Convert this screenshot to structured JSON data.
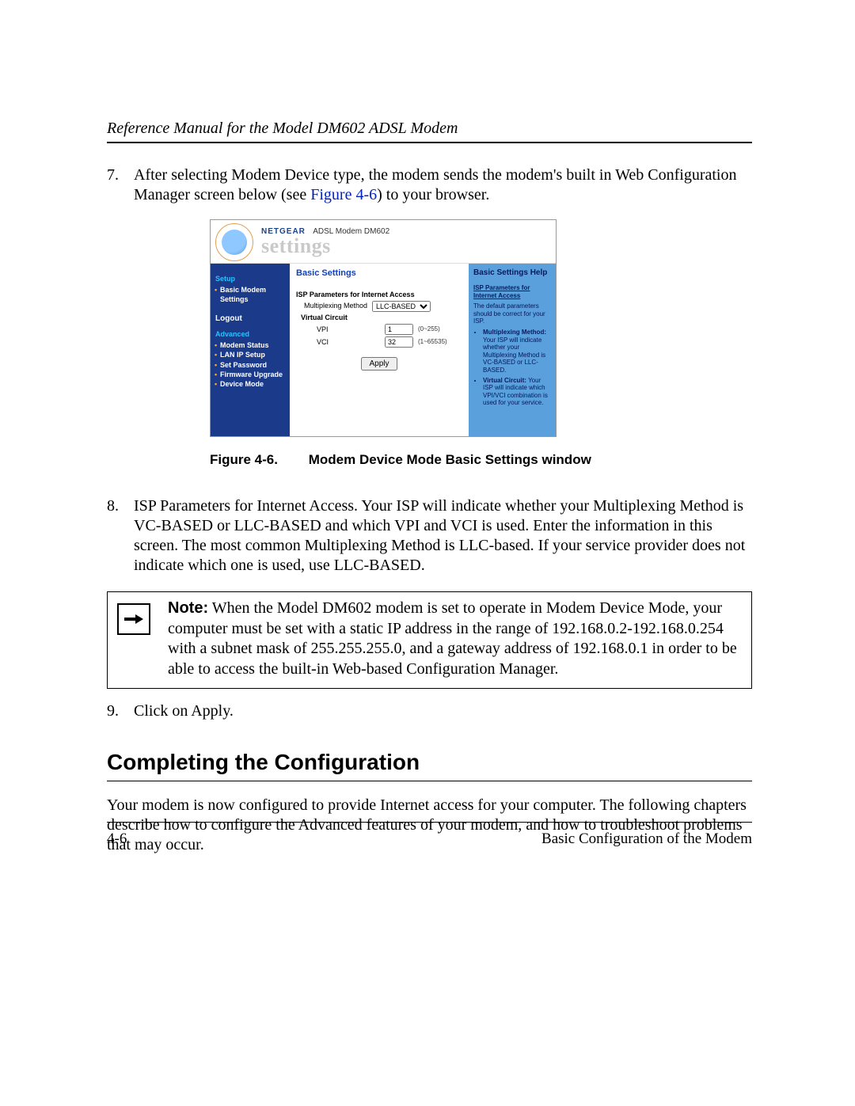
{
  "header_title": "Reference Manual for the Model DM602 ADSL Modem",
  "steps": {
    "s7": {
      "num": "7.",
      "text_pre": "After selecting Modem Device type, the modem sends the modem's built in Web Configuration Manager screen below (see ",
      "link": "Figure 4-6",
      "text_post": ") to your browser."
    },
    "s8": {
      "num": "8.",
      "text": "ISP Parameters for Internet Access. Your ISP will indicate whether your Multiplexing Method is VC-BASED or LLC-BASED and which VPI and VCI is used. Enter the information in this screen. The most common Multiplexing Method is LLC-based. If your service provider does not indicate which one is used, use LLC-BASED."
    },
    "s9": {
      "num": "9.",
      "text": "Click on Apply."
    }
  },
  "figure": {
    "brand": "NETGEAR",
    "model_line": "ADSL Modem DM602",
    "settings_word": "settings",
    "sidebar": {
      "setup": "Setup",
      "basic_modem": "Basic Modem Settings",
      "logout": "Logout",
      "advanced": "Advanced",
      "items": [
        "Modem Status",
        "LAN IP Setup",
        "Set Password",
        "Firmware Upgrade",
        "Device Mode"
      ]
    },
    "main": {
      "title": "Basic Settings",
      "subtitle": "ISP Parameters for Internet Access",
      "mux_label": "Multiplexing Method",
      "mux_value": "LLC-BASED",
      "vc_label": "Virtual Circuit",
      "vpi_label": "VPI",
      "vpi_value": "1",
      "vpi_range": "(0~255)",
      "vci_label": "VCI",
      "vci_value": "32",
      "vci_range": "(1~65535)",
      "apply": "Apply"
    },
    "help": {
      "title": "Basic Settings Help",
      "section": "ISP Parameters for Internet Access",
      "intro": "The default parameters should be correct for your ISP.",
      "b1_title": "Multiplexing Method:",
      "b1_text": "Your ISP will indicate whether your Multiplexing Method is VC-BASED or LLC-BASED.",
      "b2_title": "Virtual Circuit:",
      "b2_text": "Your ISP will indicate which VPI/VCI combination is used for your service."
    },
    "caption_label": "Figure 4-6.",
    "caption_text": "Modem Device Mode Basic Settings window"
  },
  "note": {
    "lead": "Note:",
    "text": " When the Model DM602 modem is set to operate in Modem Device Mode, your computer must be set with a static IP address in the range of 192.168.0.2-192.168.0.254 with a subnet mask of 255.255.255.0, and a gateway address of 192.168.0.1 in order to be able to access the built-in Web-based Configuration Manager."
  },
  "section_heading": "Completing the Configuration",
  "section_body": "Your modem is now configured to provide Internet access for your computer. The following chapters describe how to configure the Advanced features of your modem, and how to troubleshoot problems that may occur.",
  "footer": {
    "left": "4-6",
    "right": "Basic Configuration of the Modem"
  }
}
